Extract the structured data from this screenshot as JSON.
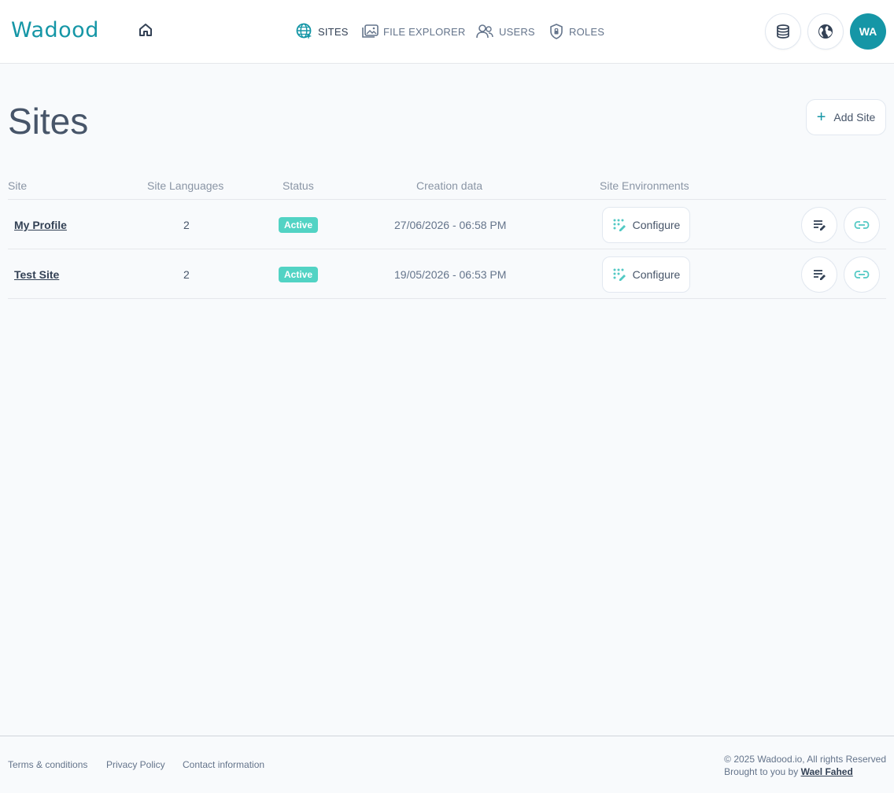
{
  "brand": {
    "logo_text": "Wadood",
    "accent_color": "#1596a6"
  },
  "header": {
    "nav": [
      {
        "label": "SITES",
        "icon": "globe-icon",
        "active": true
      },
      {
        "label": "FILE EXPLORER",
        "icon": "folder-image-icon",
        "active": false
      },
      {
        "label": "USERS",
        "icon": "users-icon",
        "active": false
      },
      {
        "label": "ROLES",
        "icon": "shield-lock-icon",
        "active": false
      }
    ],
    "avatar_initials": "WA"
  },
  "page": {
    "title": "Sites",
    "add_button_label": "Add Site"
  },
  "table": {
    "columns": [
      "Site",
      "Site Languages",
      "Status",
      "Creation data",
      "Site Environments"
    ],
    "rows": [
      {
        "site": "My Profile",
        "languages": "2",
        "status": "Active",
        "created": "27/06/2026 - 06:58 PM",
        "env_button": "Configure"
      },
      {
        "site": "Test Site",
        "languages": "2",
        "status": "Active",
        "created": "19/05/2026 - 06:53 PM",
        "env_button": "Configure"
      }
    ],
    "status_color": "#52d3c4"
  },
  "footer": {
    "links": [
      "Terms & conditions",
      "Privacy Policy",
      "Contact information"
    ],
    "copyright": "© 2025 Wadood.io, All rights Reserved",
    "brought_prefix": "Brought to you by",
    "author": "Wael Fahed"
  }
}
